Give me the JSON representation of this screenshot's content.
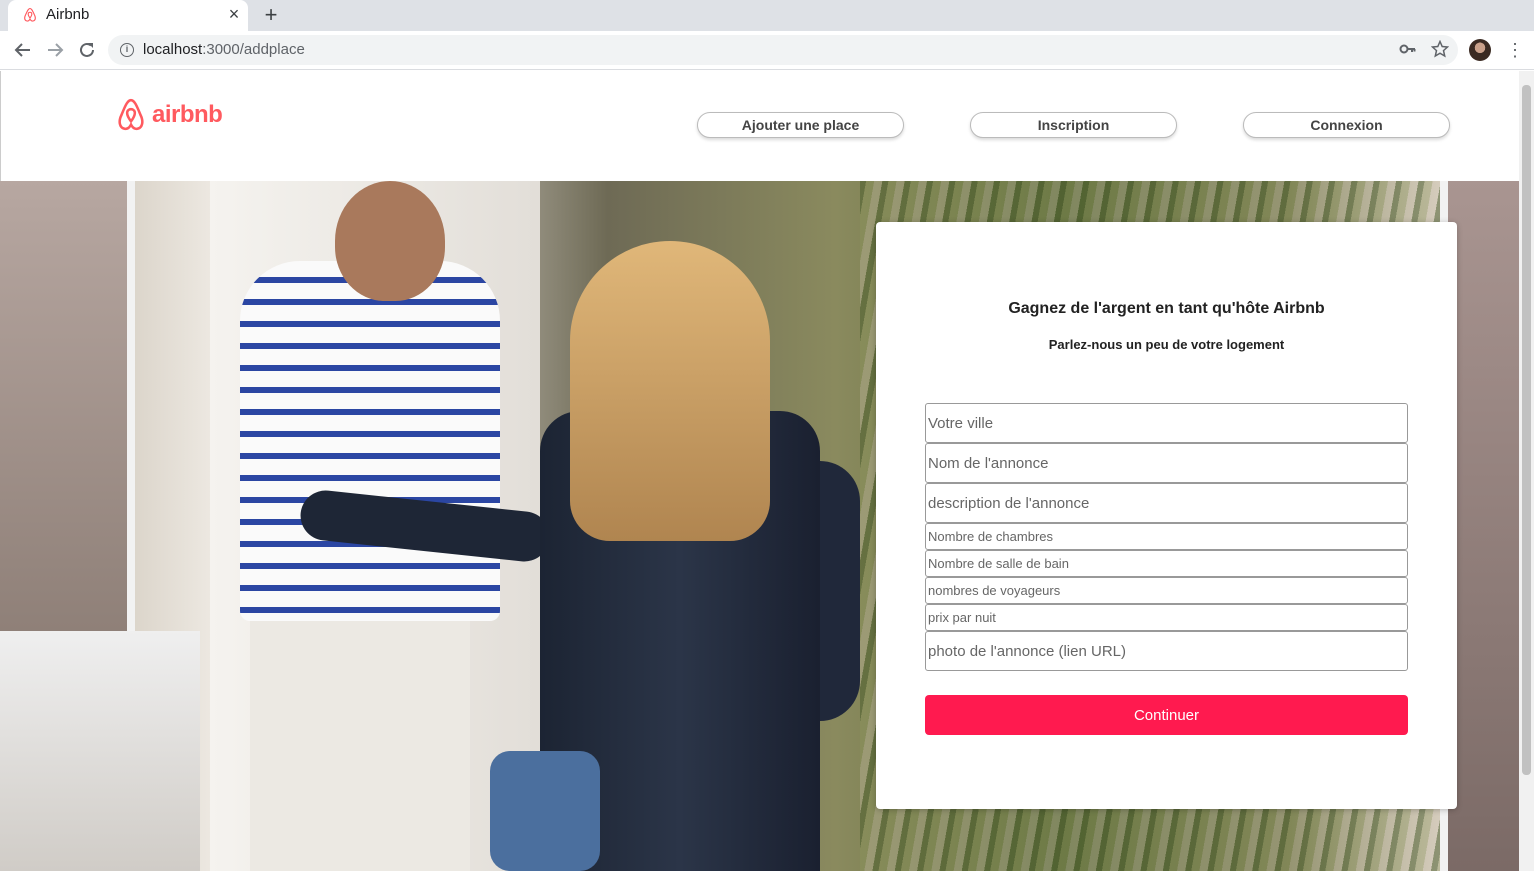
{
  "browser": {
    "tab_title": "Airbnb",
    "new_tab_label": "+",
    "close_label": "×",
    "url_host": "localhost",
    "url_path": ":3000/addplace"
  },
  "header": {
    "logo_text": "airbnb",
    "nav": [
      {
        "label": "Ajouter une place"
      },
      {
        "label": "Inscription"
      },
      {
        "label": "Connexion"
      }
    ]
  },
  "form": {
    "title": "Gagnez de l'argent en tant qu'hôte Airbnb",
    "subtitle": "Parlez-nous un peu de votre logement",
    "fields": [
      {
        "placeholder": "Votre ville",
        "value": ""
      },
      {
        "placeholder": "Nom de l'annonce",
        "value": ""
      },
      {
        "placeholder": "description de l'annonce",
        "value": ""
      },
      {
        "placeholder": "Nombre de chambres",
        "value": ""
      },
      {
        "placeholder": "Nombre de salle de bain",
        "value": ""
      },
      {
        "placeholder": "nombres de voyageurs",
        "value": ""
      },
      {
        "placeholder": "prix par nuit",
        "value": ""
      },
      {
        "placeholder": "photo de l'annonce (lien URL)",
        "value": ""
      }
    ],
    "submit_label": "Continuer"
  },
  "colors": {
    "brand": "#ff5a5f",
    "submit": "#ff1a4f"
  },
  "icons": [
    "airbnb-logo-icon",
    "back-icon",
    "forward-icon",
    "reload-icon",
    "info-icon",
    "key-icon",
    "star-icon",
    "menu-icon"
  ]
}
